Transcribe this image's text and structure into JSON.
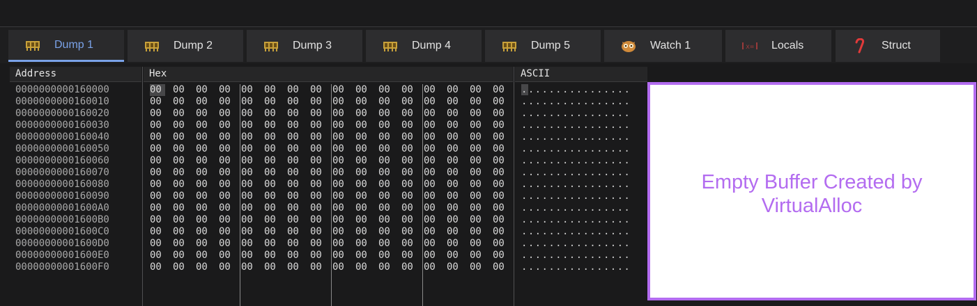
{
  "tabs": [
    {
      "label": "Dump 1",
      "icon": "memory-icon",
      "active": true
    },
    {
      "label": "Dump 2",
      "icon": "memory-icon"
    },
    {
      "label": "Dump 3",
      "icon": "memory-icon"
    },
    {
      "label": "Dump 4",
      "icon": "memory-icon"
    },
    {
      "label": "Dump 5",
      "icon": "memory-icon"
    },
    {
      "label": "Watch 1",
      "icon": "owl-icon"
    },
    {
      "label": "Locals",
      "icon": "locals-icon"
    },
    {
      "label": "Struct",
      "icon": "struct-icon"
    }
  ],
  "columns": {
    "address": "Address",
    "hex": "Hex",
    "ascii": "ASCII"
  },
  "rows": [
    {
      "address": "0000000000160000",
      "hex": [
        "00",
        "00",
        "00",
        "00",
        "00",
        "00",
        "00",
        "00",
        "00",
        "00",
        "00",
        "00",
        "00",
        "00",
        "00",
        "00"
      ],
      "ascii": "................"
    },
    {
      "address": "0000000000160010",
      "hex": [
        "00",
        "00",
        "00",
        "00",
        "00",
        "00",
        "00",
        "00",
        "00",
        "00",
        "00",
        "00",
        "00",
        "00",
        "00",
        "00"
      ],
      "ascii": "................"
    },
    {
      "address": "0000000000160020",
      "hex": [
        "00",
        "00",
        "00",
        "00",
        "00",
        "00",
        "00",
        "00",
        "00",
        "00",
        "00",
        "00",
        "00",
        "00",
        "00",
        "00"
      ],
      "ascii": "................"
    },
    {
      "address": "0000000000160030",
      "hex": [
        "00",
        "00",
        "00",
        "00",
        "00",
        "00",
        "00",
        "00",
        "00",
        "00",
        "00",
        "00",
        "00",
        "00",
        "00",
        "00"
      ],
      "ascii": "................"
    },
    {
      "address": "0000000000160040",
      "hex": [
        "00",
        "00",
        "00",
        "00",
        "00",
        "00",
        "00",
        "00",
        "00",
        "00",
        "00",
        "00",
        "00",
        "00",
        "00",
        "00"
      ],
      "ascii": "................"
    },
    {
      "address": "0000000000160050",
      "hex": [
        "00",
        "00",
        "00",
        "00",
        "00",
        "00",
        "00",
        "00",
        "00",
        "00",
        "00",
        "00",
        "00",
        "00",
        "00",
        "00"
      ],
      "ascii": "................"
    },
    {
      "address": "0000000000160060",
      "hex": [
        "00",
        "00",
        "00",
        "00",
        "00",
        "00",
        "00",
        "00",
        "00",
        "00",
        "00",
        "00",
        "00",
        "00",
        "00",
        "00"
      ],
      "ascii": "................"
    },
    {
      "address": "0000000000160070",
      "hex": [
        "00",
        "00",
        "00",
        "00",
        "00",
        "00",
        "00",
        "00",
        "00",
        "00",
        "00",
        "00",
        "00",
        "00",
        "00",
        "00"
      ],
      "ascii": "................"
    },
    {
      "address": "0000000000160080",
      "hex": [
        "00",
        "00",
        "00",
        "00",
        "00",
        "00",
        "00",
        "00",
        "00",
        "00",
        "00",
        "00",
        "00",
        "00",
        "00",
        "00"
      ],
      "ascii": "................"
    },
    {
      "address": "0000000000160090",
      "hex": [
        "00",
        "00",
        "00",
        "00",
        "00",
        "00",
        "00",
        "00",
        "00",
        "00",
        "00",
        "00",
        "00",
        "00",
        "00",
        "00"
      ],
      "ascii": "................"
    },
    {
      "address": "00000000001600A0",
      "hex": [
        "00",
        "00",
        "00",
        "00",
        "00",
        "00",
        "00",
        "00",
        "00",
        "00",
        "00",
        "00",
        "00",
        "00",
        "00",
        "00"
      ],
      "ascii": "................"
    },
    {
      "address": "00000000001600B0",
      "hex": [
        "00",
        "00",
        "00",
        "00",
        "00",
        "00",
        "00",
        "00",
        "00",
        "00",
        "00",
        "00",
        "00",
        "00",
        "00",
        "00"
      ],
      "ascii": "................"
    },
    {
      "address": "00000000001600C0",
      "hex": [
        "00",
        "00",
        "00",
        "00",
        "00",
        "00",
        "00",
        "00",
        "00",
        "00",
        "00",
        "00",
        "00",
        "00",
        "00",
        "00"
      ],
      "ascii": "................"
    },
    {
      "address": "00000000001600D0",
      "hex": [
        "00",
        "00",
        "00",
        "00",
        "00",
        "00",
        "00",
        "00",
        "00",
        "00",
        "00",
        "00",
        "00",
        "00",
        "00",
        "00"
      ],
      "ascii": "................"
    },
    {
      "address": "00000000001600E0",
      "hex": [
        "00",
        "00",
        "00",
        "00",
        "00",
        "00",
        "00",
        "00",
        "00",
        "00",
        "00",
        "00",
        "00",
        "00",
        "00",
        "00"
      ],
      "ascii": "................"
    },
    {
      "address": "00000000001600F0",
      "hex": [
        "00",
        "00",
        "00",
        "00",
        "00",
        "00",
        "00",
        "00",
        "00",
        "00",
        "00",
        "00",
        "00",
        "00",
        "00",
        "00"
      ],
      "ascii": "................"
    }
  ],
  "annotation": {
    "text_line1": "Empty Buffer Created by",
    "text_line2": "VirtualAlloc",
    "color": "#b36cf0"
  },
  "colors": {
    "active_tab": "#7aa2e8",
    "background": "#1a1a1b"
  }
}
